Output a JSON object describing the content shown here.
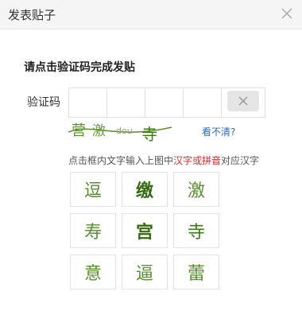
{
  "dialog": {
    "title": "发表贴子",
    "close_icon": "close-icon"
  },
  "form": {
    "heading": "请点击验证码完成发贴",
    "label": "验证码",
    "code_cells": [
      "",
      "",
      "",
      "",
      ""
    ],
    "refresh_text": "看不清?",
    "instruction_prefix": "点击框内文字输入上图中",
    "instruction_highlight": "汉字或拼音",
    "instruction_suffix": "对应汉字"
  },
  "captcha": {
    "chars": [
      "营",
      "激",
      "dou",
      "寺"
    ],
    "color": "#5a8f2e"
  },
  "grid": {
    "chars": [
      "逗",
      "缴",
      "激",
      "寿",
      "宫",
      "寺",
      "意",
      "逼",
      "蕾"
    ]
  },
  "colors": {
    "accent_link": "#2e6bb5",
    "highlight": "#d32f2f",
    "char_green": "#5a8f2e"
  }
}
